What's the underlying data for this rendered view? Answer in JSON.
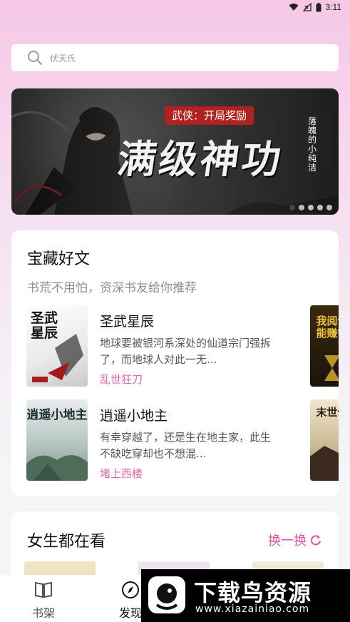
{
  "status_bar": {
    "time": "3:11"
  },
  "search": {
    "placeholder": "伏天氏"
  },
  "banner": {
    "tag": "武侠：开局奖励",
    "headline": "满级神功",
    "side_text": "落魄的小纯洁",
    "slides": 5,
    "active_slide": 1
  },
  "treasure_section": {
    "title": "宝藏好文",
    "subtitle": "书荒不用怕，资深书友给你推荐",
    "books": [
      {
        "title": "圣武星辰",
        "description": "地球要被银河系深处的仙道宗门强拆了，而地球人对此一无...",
        "author": "乱世狂刀",
        "cover_text": "圣武星辰"
      },
      {
        "title": "逍遥小地主",
        "description": "有幸穿越了，还是生在地主家，此生不缺吃穿却也不想混...",
        "author": "堵上西楼",
        "cover_text": "逍遥小地主"
      }
    ],
    "peek_covers": [
      "我阅读能赚钱",
      "末世仙"
    ]
  },
  "girls_section": {
    "title": "女生都在看",
    "refresh_label": "换一换"
  },
  "tabbar": {
    "tabs": [
      {
        "label": "书架",
        "icon": "book-icon"
      },
      {
        "label": "发现",
        "icon": "compass-icon"
      }
    ]
  },
  "watermark": {
    "title": "下载鸟资源",
    "url": "www.xiazainiao.com"
  },
  "colors": {
    "accent": "#e0559a",
    "author": "#e265a3",
    "banner_tag": "#b1211f"
  }
}
